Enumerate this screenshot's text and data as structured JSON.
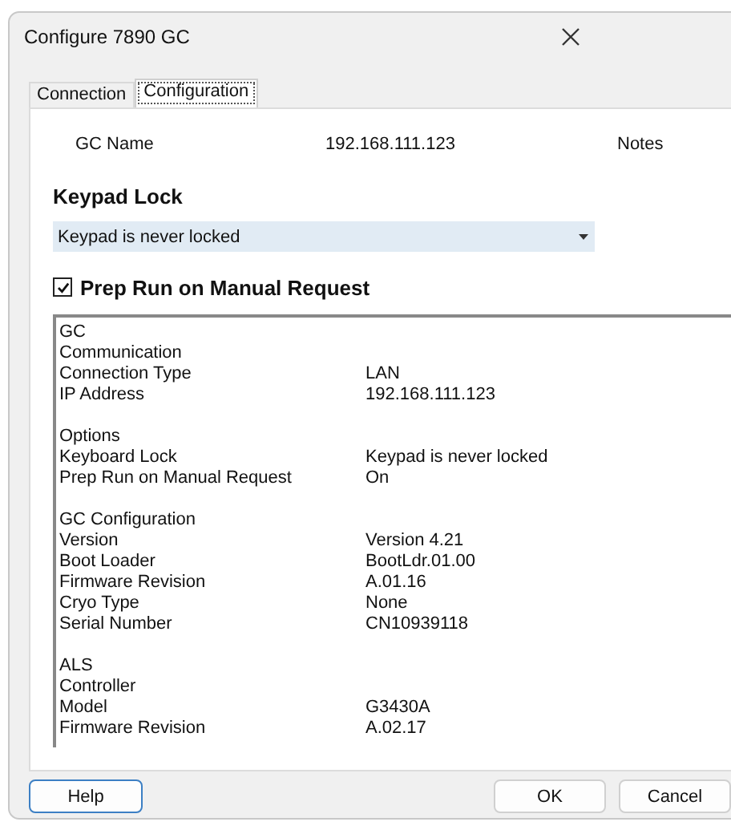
{
  "window": {
    "title": "Configure 7890 GC"
  },
  "tabs": [
    {
      "label": "Connection",
      "selected": false
    },
    {
      "label": "Configuration",
      "selected": true
    }
  ],
  "gc_name": {
    "label": "GC Name",
    "value": "192.168.111.123",
    "notes": "Notes"
  },
  "keypad_lock": {
    "heading": "Keypad Lock",
    "value": "Keypad is never locked"
  },
  "prep_run": {
    "label": "Prep Run on Manual Request",
    "checked": true
  },
  "info": [
    {
      "lines": [
        {
          "label": "GC"
        },
        {
          "label": "Communication"
        },
        {
          "label": "Connection Type",
          "value": "LAN"
        },
        {
          "label": "IP Address",
          "value": "192.168.111.123"
        }
      ]
    },
    {
      "lines": [
        {
          "label": "Options"
        },
        {
          "label": "Keyboard Lock",
          "value": "Keypad is never locked"
        },
        {
          "label": "Prep Run on Manual Request",
          "value": "On"
        }
      ]
    },
    {
      "lines": [
        {
          "label": "GC Configuration"
        },
        {
          "label": "Version",
          "value": "Version 4.21"
        },
        {
          "label": "Boot Loader",
          "value": "BootLdr.01.00"
        },
        {
          "label": "Firmware Revision",
          "value": "A.01.16"
        },
        {
          "label": "Cryo Type",
          "value": "None"
        },
        {
          "label": "Serial Number",
          "value": "CN10939118"
        }
      ]
    },
    {
      "lines": [
        {
          "label": "ALS"
        },
        {
          "label": "Controller"
        },
        {
          "label": "Model",
          "value": "G3430A"
        },
        {
          "label": "Firmware Revision",
          "value": "A.02.17"
        }
      ]
    }
  ],
  "buttons": {
    "help": "Help",
    "ok": "OK",
    "cancel": "Cancel"
  }
}
